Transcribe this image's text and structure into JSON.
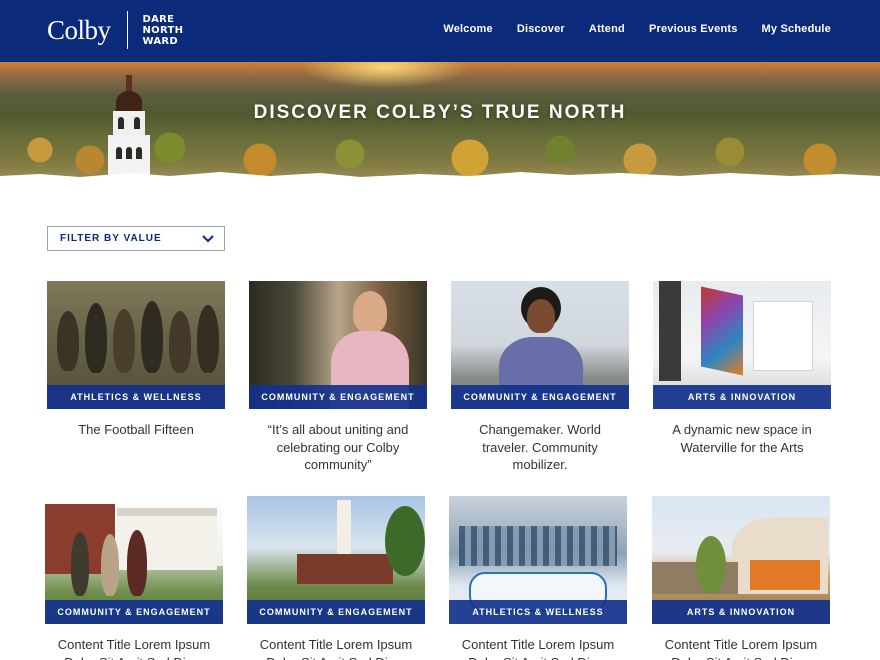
{
  "header": {
    "brand": "Colby",
    "tagline": [
      "DARE",
      "NORTH",
      "WARD"
    ],
    "nav": [
      "Welcome",
      "Discover",
      "Attend",
      "Previous Events",
      "My Schedule"
    ]
  },
  "hero": {
    "title": "DISCOVER COLBY’S TRUE NORTH"
  },
  "filter": {
    "label": "FILTER BY VALUE",
    "icon": "chevron-down-icon"
  },
  "cards": [
    {
      "tag": "ATHLETICS & WELLNESS",
      "title": "The Football Fifteen"
    },
    {
      "tag": "COMMUNITY & ENGAGEMENT",
      "title": "“It’s all about uniting and celebrating our Colby community”"
    },
    {
      "tag": "COMMUNITY & ENGAGEMENT",
      "title": "Changemaker. World traveler. Community mobilizer."
    },
    {
      "tag": "ARTS & INNOVATION",
      "title": "A dynamic new space in Waterville for the Arts"
    },
    {
      "tag": "COMMUNITY & ENGAGEMENT",
      "title": "Content Title Lorem Ipsum Dolor Sit Amit Sed Diam"
    },
    {
      "tag": "COMMUNITY & ENGAGEMENT",
      "title": "Content Title Lorem Ipsum Dolor Sit Amit Sed Diam"
    },
    {
      "tag": "ATHLETICS & WELLNESS",
      "title": "Content Title Lorem Ipsum Dolor Sit Amit Sed Diam"
    },
    {
      "tag": "ARTS & INNOVATION",
      "title": "Content Title Lorem Ipsum Dolor Sit Amit Sed Diam"
    }
  ],
  "colors": {
    "brand_navy": "#0b2a7a",
    "tag_blue": "#14328c"
  }
}
